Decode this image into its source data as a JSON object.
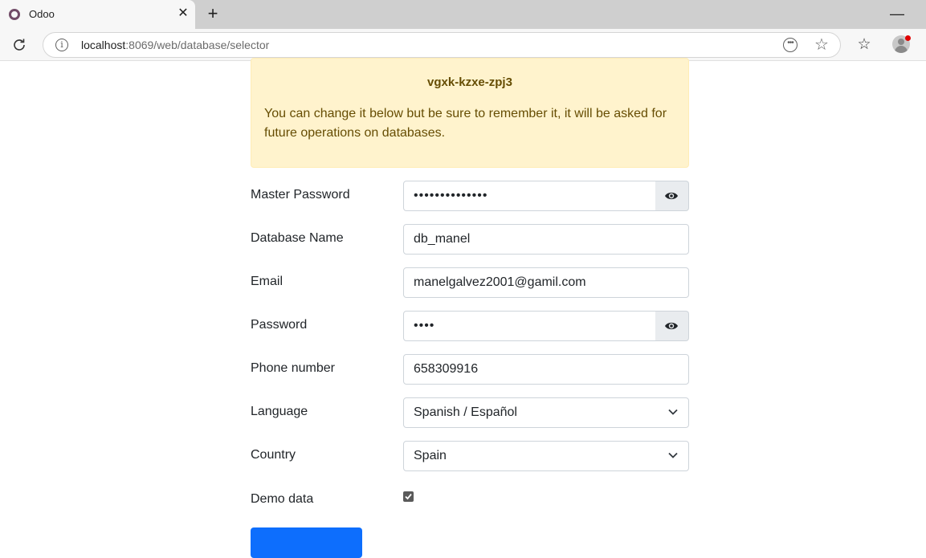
{
  "browser": {
    "tab_title": "Odoo",
    "url_host": "localhost",
    "url_rest": ":8069/web/database/selector"
  },
  "alert": {
    "code": "vgxk-kzxe-zpj3",
    "message": "You can change it below but be sure to remember it, it will be asked for future operations on databases."
  },
  "form": {
    "master_password": {
      "label": "Master Password",
      "value": "••••••••••••••"
    },
    "database_name": {
      "label": "Database Name",
      "value": "db_manel"
    },
    "email": {
      "label": "Email",
      "value": "manelgalvez2001@gamil.com"
    },
    "password": {
      "label": "Password",
      "value": "••••"
    },
    "phone": {
      "label": "Phone number",
      "value": "658309916"
    },
    "language": {
      "label": "Language",
      "value": "Spanish / Español"
    },
    "country": {
      "label": "Country",
      "value": "Spain"
    },
    "demo_data": {
      "label": "Demo data",
      "checked": true
    }
  },
  "colors": {
    "alert_bg": "#fff3cd",
    "alert_text": "#664d03",
    "primary": "#0d6efd",
    "odoo_brand": "#714b67"
  },
  "icons": [
    "odoo-favicon",
    "close-icon",
    "plus-icon",
    "minimize-icon",
    "reload-icon",
    "info-icon",
    "reader-icon",
    "star-icon",
    "favorites-icon",
    "profile-icon",
    "eye-icon",
    "chevron-down-icon",
    "checkmark-icon"
  ]
}
